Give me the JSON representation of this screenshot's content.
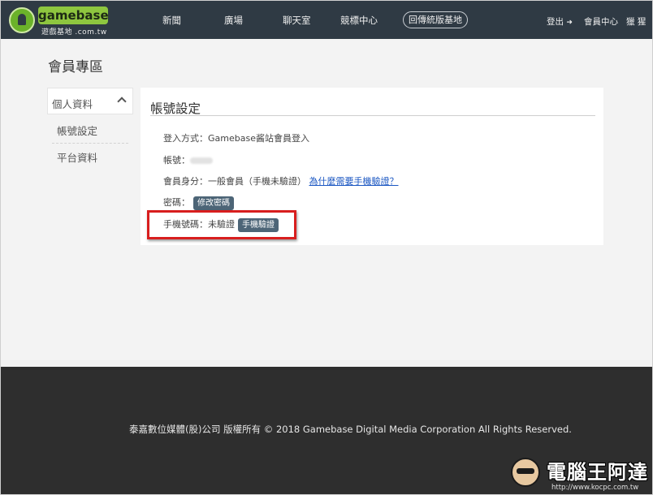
{
  "header": {
    "logo": {
      "name": "gamebase",
      "sub": "遊戲基地 .com.tw"
    },
    "nav": [
      "新聞",
      "廣場",
      "聊天室",
      "競標中心"
    ],
    "nav_pill": "回傳統版基地",
    "logout": "登出",
    "member_center": "會員中心",
    "user": "獵 猩"
  },
  "page": {
    "title": "會員專區"
  },
  "sidebar": {
    "section_label": "個人資料",
    "items": [
      "帳號設定",
      "平台資料"
    ]
  },
  "panel": {
    "title": "帳號設定",
    "login_method": "登入方式：Gamebase酱站會員登入",
    "account_label": "帳號：",
    "identity": "會員身分：一般會員（手機未驗證）",
    "identity_link": "為什麼需要手機驗證？",
    "password_label": "密碼：",
    "password_button": "修改密碼",
    "phone_label": "手機號碼：未驗證",
    "phone_button": "手機驗證"
  },
  "footer": {
    "copyright": "泰嘉數位媒體(股)公司 版權所有 © 2018 Gamebase Digital Media Corporation All Rights Reserved."
  },
  "watermark": {
    "text": "電腦王阿達",
    "url": "http://www.kocpc.com.tw"
  },
  "colors": {
    "header_bg": "#2f3a44",
    "footer_bg": "#2e2e2e",
    "button_bg": "#4d6577",
    "link": "#1a56c2",
    "highlight": "#d81e1e",
    "logo_green": "#8ec63f"
  }
}
